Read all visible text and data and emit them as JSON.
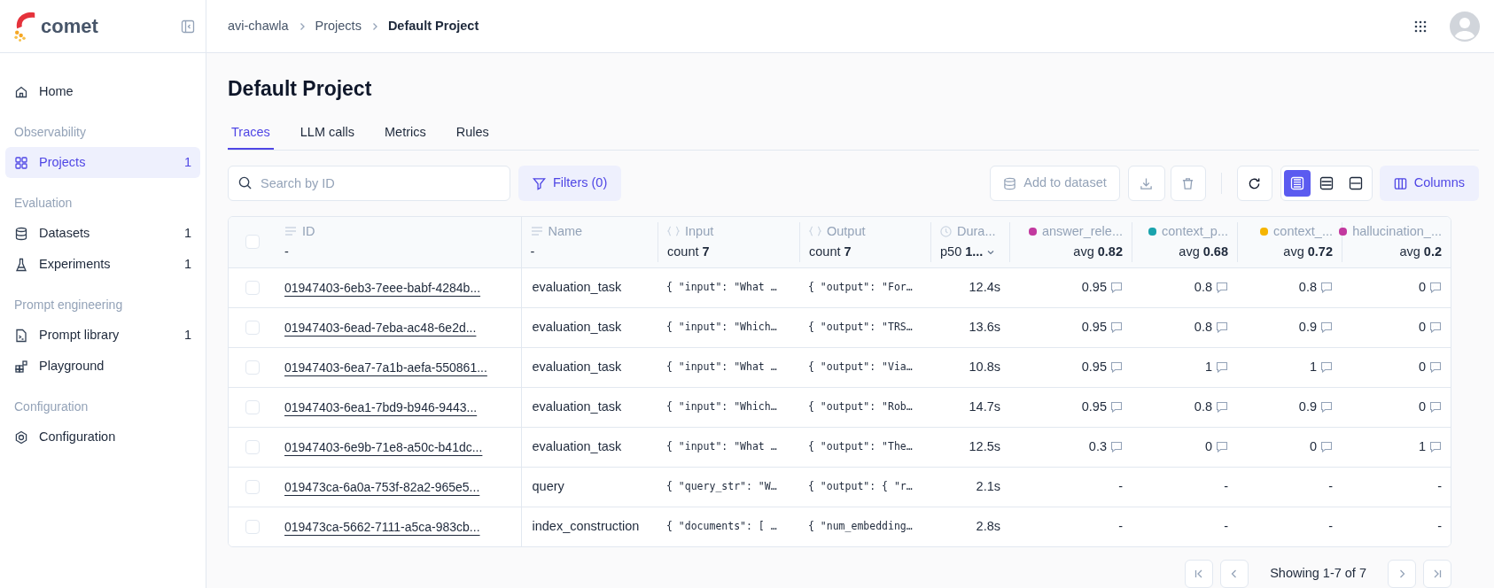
{
  "app": {
    "logo_text": "comet"
  },
  "breadcrumbs": [
    {
      "label": "avi-chawla",
      "current": false
    },
    {
      "label": "Projects",
      "current": false
    },
    {
      "label": "Default Project",
      "current": true
    }
  ],
  "sidebar": {
    "sections": [
      {
        "items": [
          {
            "label": "Home",
            "kind": "home",
            "selected": false
          }
        ]
      },
      {
        "heading": "Observability",
        "items": [
          {
            "label": "Projects",
            "kind": "grid",
            "count": "1",
            "selected": true
          }
        ]
      },
      {
        "heading": "Evaluation",
        "items": [
          {
            "label": "Datasets",
            "kind": "database",
            "count": "1",
            "selected": false
          },
          {
            "label": "Experiments",
            "kind": "flask",
            "count": "1",
            "selected": false
          }
        ]
      },
      {
        "heading": "Prompt engineering",
        "items": [
          {
            "label": "Prompt library",
            "kind": "file",
            "count": "1",
            "selected": false
          },
          {
            "label": "Playground",
            "kind": "blocks",
            "selected": false
          }
        ]
      },
      {
        "heading": "Configuration",
        "items": [
          {
            "label": "Configuration",
            "kind": "gear",
            "selected": false
          }
        ]
      }
    ]
  },
  "page_title": "Default Project",
  "tabs": [
    {
      "label": "Traces",
      "selected": true
    },
    {
      "label": "LLM calls",
      "selected": false
    },
    {
      "label": "Metrics",
      "selected": false
    },
    {
      "label": "Rules",
      "selected": false
    }
  ],
  "toolbar": {
    "search": {
      "placeholder": "Search by ID"
    },
    "filters": "Filters (0)",
    "add_to_dataset": {
      "label": "Add to dataset",
      "disabled": true
    },
    "row_height": [
      {
        "kind": "small",
        "selected": true
      },
      {
        "kind": "medium",
        "selected": false
      },
      {
        "kind": "large",
        "selected": false
      }
    ],
    "columns": "Columns"
  },
  "table": {
    "select_all": false,
    "columns": [
      {
        "kind": "text",
        "label": "ID",
        "summary": "-"
      },
      {
        "kind": "text",
        "label": "Name",
        "summary": "-"
      },
      {
        "kind": "json",
        "label": "Input",
        "summary": "count **7**"
      },
      {
        "kind": "json",
        "label": "Output",
        "summary": "count **7**"
      },
      {
        "kind": "duration",
        "label": "Dura...",
        "summary": "p50 **1...**"
      },
      {
        "kind": "score",
        "label": "answer_rele...",
        "color": "#c2399f",
        "summary": "avg **0.82**"
      },
      {
        "kind": "score",
        "label": "context_p...",
        "color": "#1aa3ad",
        "summary": "avg **0.68**"
      },
      {
        "kind": "score",
        "label": "context_...",
        "color": "#f5b400",
        "summary": "avg **0.72**"
      },
      {
        "kind": "score",
        "label": "hallucination_...",
        "color": "#c2399f",
        "summary": "avg **0.2**"
      }
    ],
    "rows": [
      {
        "selected": false,
        "id": "01947403-6eb3-7eee-babf-4284b...",
        "name": "evaluation_task",
        "input": "{ \"input\": \"What …",
        "output": "{ \"output\": \"For…",
        "duration": "12.4s",
        "scores": [
          {
            "value": "0.95",
            "comment": true
          },
          {
            "value": "0.8",
            "comment": true
          },
          {
            "value": "0.8",
            "comment": true
          },
          {
            "value": "0",
            "comment": true
          }
        ]
      },
      {
        "selected": false,
        "id": "01947403-6ead-7eba-ac48-6e2d...",
        "name": "evaluation_task",
        "input": "{ \"input\": \"Which…",
        "output": "{ \"output\": \"TRS…",
        "duration": "13.6s",
        "scores": [
          {
            "value": "0.95",
            "comment": true
          },
          {
            "value": "0.8",
            "comment": true
          },
          {
            "value": "0.9",
            "comment": true
          },
          {
            "value": "0",
            "comment": true
          }
        ]
      },
      {
        "selected": false,
        "id": "01947403-6ea7-7a1b-aefa-550861...",
        "name": "evaluation_task",
        "input": "{ \"input\": \"What …",
        "output": "{ \"output\": \"Via…",
        "duration": "10.8s",
        "scores": [
          {
            "value": "0.95",
            "comment": true
          },
          {
            "value": "1",
            "comment": true
          },
          {
            "value": "1",
            "comment": true
          },
          {
            "value": "0",
            "comment": true
          }
        ]
      },
      {
        "selected": false,
        "id": "01947403-6ea1-7bd9-b946-9443...",
        "name": "evaluation_task",
        "input": "{ \"input\": \"Which…",
        "output": "{ \"output\": \"Rob…",
        "duration": "14.7s",
        "scores": [
          {
            "value": "0.95",
            "comment": true
          },
          {
            "value": "0.8",
            "comment": true
          },
          {
            "value": "0.9",
            "comment": true
          },
          {
            "value": "0",
            "comment": true
          }
        ]
      },
      {
        "selected": false,
        "id": "01947403-6e9b-71e8-a50c-b41dc...",
        "name": "evaluation_task",
        "input": "{ \"input\": \"What …",
        "output": "{ \"output\": \"The…",
        "duration": "12.5s",
        "scores": [
          {
            "value": "0.3",
            "comment": true
          },
          {
            "value": "0",
            "comment": true
          },
          {
            "value": "0",
            "comment": true
          },
          {
            "value": "1",
            "comment": true
          }
        ]
      },
      {
        "selected": false,
        "id": "019473ca-6a0a-753f-82a2-965e5...",
        "name": "query",
        "input": "{ \"query_str\": \"W…",
        "output": "{ \"output\": { \"r…",
        "duration": "2.1s",
        "scores": [
          {
            "value": "-",
            "comment": false
          },
          {
            "value": "-",
            "comment": false
          },
          {
            "value": "-",
            "comment": false
          },
          {
            "value": "-",
            "comment": false
          }
        ]
      },
      {
        "selected": false,
        "id": "019473ca-5662-7111-a5ca-983cb...",
        "name": "index_construction",
        "input": "{ \"documents\": [ …",
        "output": "{ \"num_embedding…",
        "duration": "2.8s",
        "scores": [
          {
            "value": "-",
            "comment": false
          },
          {
            "value": "-",
            "comment": false
          },
          {
            "value": "-",
            "comment": false
          },
          {
            "value": "-",
            "comment": false
          }
        ]
      }
    ]
  },
  "pagination": {
    "label": "Showing 1-7 of 7"
  }
}
